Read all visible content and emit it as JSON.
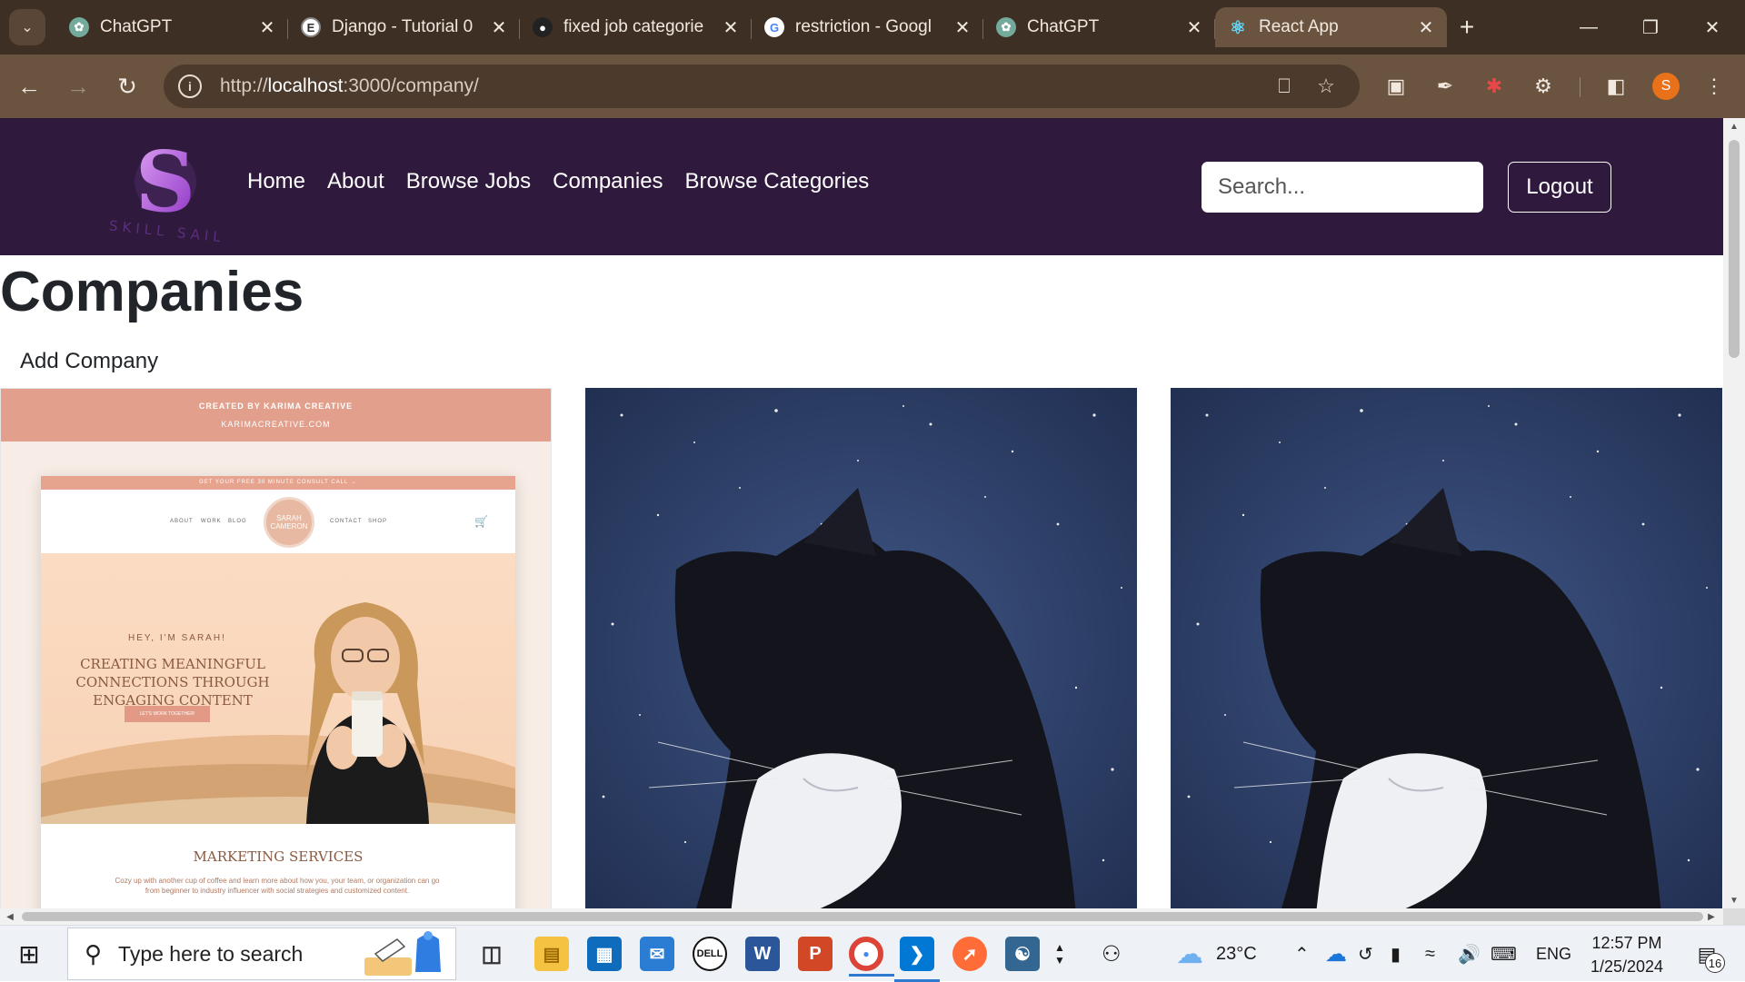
{
  "browser": {
    "tabs": [
      {
        "title": "ChatGPT",
        "icon": "chatgpt-icon",
        "active": false
      },
      {
        "title": "Django - Tutorial 0",
        "icon": "django-icon",
        "active": false
      },
      {
        "title": "fixed job categorie",
        "icon": "github-icon",
        "active": false
      },
      {
        "title": "restriction - Googl",
        "icon": "google-icon",
        "active": false
      },
      {
        "title": "ChatGPT",
        "icon": "chatgpt-icon",
        "active": false
      },
      {
        "title": "React App",
        "icon": "react-icon",
        "active": true
      }
    ],
    "url_prefix": "http://",
    "url_host": "localhost",
    "url_rest": ":3000/company/",
    "profile_initial": "S"
  },
  "app": {
    "logo_letter": "S",
    "logo_text": "SKILL SAIL",
    "nav": {
      "home": "Home",
      "about": "About",
      "browse_jobs": "Browse Jobs",
      "companies": "Companies",
      "browse_categories": "Browse Categories"
    },
    "search_placeholder": "Search...",
    "logout_label": "Logout",
    "page_title": "Companies",
    "add_company_label": "Add Company",
    "cards": [
      {
        "banner_line1": "CREATED BY KARIMA CREATIVE",
        "banner_line2": "KARIMACREATIVE.COM",
        "topbar": "GET YOUR FREE 30 MINUTE CONSULT CALL →",
        "menu": [
          "ABOUT",
          "WORK",
          "BLOG",
          "CONTACT",
          "SHOP"
        ],
        "badge": "SARAH CAMERON",
        "hey": "HEY, I'M SARAH!",
        "headline": "CREATING MEANINGFUL CONNECTIONS THROUGH ENGAGING CONTENT",
        "cta": "LET'S WORK TOGETHER!",
        "services_title": "MARKETING SERVICES",
        "services_desc": "Cozy up with another cup of coffee and learn more about how you, your team, or organization can go from beginner to industry influencer with social strategies and customized content."
      },
      {
        "image": "cat-in-space"
      },
      {
        "image": "cat-in-space"
      }
    ]
  },
  "taskbar": {
    "search_placeholder": "Type here to search",
    "weather": "23°C",
    "language": "ENG",
    "time": "12:57 PM",
    "date": "1/25/2024",
    "notifications": "16"
  }
}
